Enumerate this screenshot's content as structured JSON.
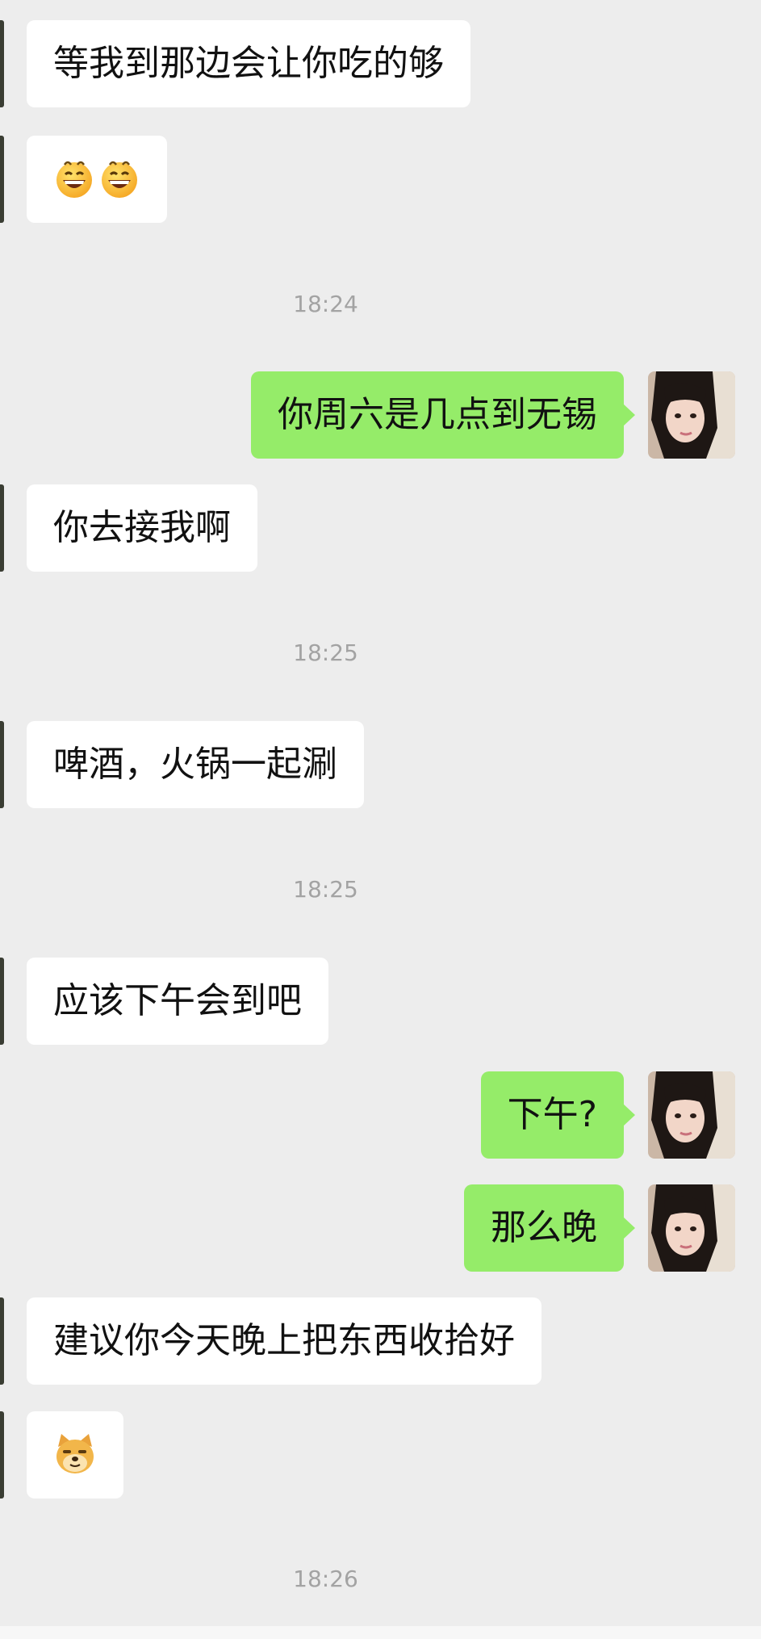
{
  "messages": [
    {
      "kind": "in",
      "text": "等我到那边会让你吃的够"
    },
    {
      "kind": "in",
      "emoji": [
        "grinning-sweat-emoji",
        "grinning-sweat-emoji"
      ]
    },
    {
      "kind": "time",
      "text": "18:24"
    },
    {
      "kind": "out",
      "text": "你周六是几点到无锡"
    },
    {
      "kind": "in",
      "text": "你去接我啊"
    },
    {
      "kind": "time",
      "text": "18:25"
    },
    {
      "kind": "in",
      "text": "啤酒，火锅一起涮"
    },
    {
      "kind": "time",
      "text": "18:25"
    },
    {
      "kind": "in",
      "text": "应该下午会到吧"
    },
    {
      "kind": "out",
      "text": "下午?"
    },
    {
      "kind": "out",
      "text": "那么晚"
    },
    {
      "kind": "in",
      "text": "建议你今天晚上把东西收拾好"
    },
    {
      "kind": "in",
      "emoji": [
        "doge-emoji"
      ]
    },
    {
      "kind": "time",
      "text": "18:26"
    }
  ],
  "colors": {
    "background": "#ededed",
    "incoming_bubble": "#ffffff",
    "outgoing_bubble": "#95ec69",
    "timestamp": "#a3a3a3"
  }
}
